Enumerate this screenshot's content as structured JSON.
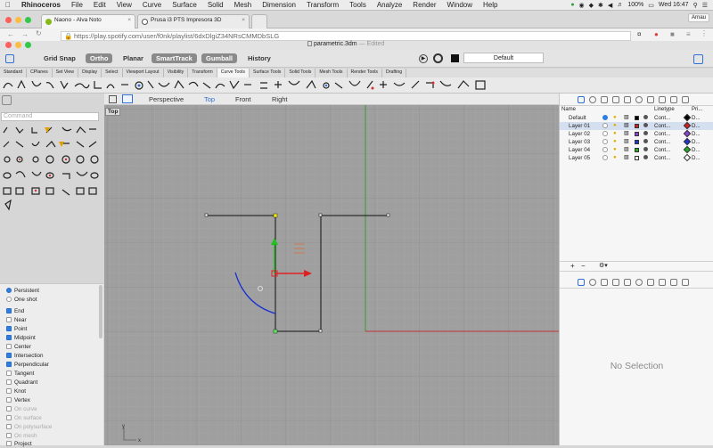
{
  "menubar": {
    "app": "Rhinoceros",
    "items": [
      "File",
      "Edit",
      "View",
      "Curve",
      "Surface",
      "Solid",
      "Mesh",
      "Dimension",
      "Transform",
      "Tools",
      "Analyze",
      "Render",
      "Window",
      "Help"
    ],
    "battery": "100%",
    "clock": "Wed 16:47"
  },
  "browser": {
    "tabs": [
      {
        "label": "Naono - Alva Noto"
      },
      {
        "label": "Prusa i3 PTS Impresora 3D"
      }
    ],
    "user": "Arnau",
    "url": "https://play.spotify.com/user/f0nk/playlist/6dxDlgiZ34NRsCMMDbSLG"
  },
  "rhino": {
    "doc_title": "parametric.3dm",
    "doc_status": "— Edited",
    "modes": [
      {
        "label": "Grid Snap",
        "on": false
      },
      {
        "label": "Ortho",
        "on": true
      },
      {
        "label": "Planar",
        "on": false
      },
      {
        "label": "SmartTrack",
        "on": true
      },
      {
        "label": "Gumball",
        "on": true
      },
      {
        "label": "History",
        "on": false
      }
    ],
    "layer_field": "Default",
    "toolbar_tabs": [
      "Standard",
      "CPlanes",
      "Set View",
      "Display",
      "Select",
      "Viewport Layout",
      "Visibility",
      "Transform",
      "Curve Tools",
      "Surface Tools",
      "Solid Tools",
      "Mesh Tools",
      "Render Tools",
      "Drafting"
    ],
    "active_toolbar_tab": "Curve Tools",
    "command_placeholder": "Command",
    "viewport_tabs": [
      "Perspective",
      "Top",
      "Front",
      "Right"
    ],
    "active_viewport": "Top",
    "viewport_label": "Top",
    "axis_y": "y",
    "axis_x": "x"
  },
  "osnap": {
    "modes": [
      {
        "label": "Persistent",
        "kind": "radio",
        "on": true
      },
      {
        "label": "One shot",
        "kind": "radio",
        "on": false
      }
    ],
    "items": [
      {
        "label": "End",
        "on": true,
        "dim": false
      },
      {
        "label": "Near",
        "on": false,
        "dim": false
      },
      {
        "label": "Point",
        "on": true,
        "dim": false
      },
      {
        "label": "Midpoint",
        "on": true,
        "dim": false
      },
      {
        "label": "Center",
        "on": false,
        "dim": false
      },
      {
        "label": "Intersection",
        "on": true,
        "dim": false
      },
      {
        "label": "Perpendicular",
        "on": true,
        "dim": false
      },
      {
        "label": "Tangent",
        "on": false,
        "dim": false
      },
      {
        "label": "Quadrant",
        "on": false,
        "dim": false
      },
      {
        "label": "Knot",
        "on": false,
        "dim": false
      },
      {
        "label": "Vertex",
        "on": false,
        "dim": false
      },
      {
        "label": "On curve",
        "on": false,
        "dim": true
      },
      {
        "label": "On surface",
        "on": false,
        "dim": true
      },
      {
        "label": "On polysurface",
        "on": false,
        "dim": true
      },
      {
        "label": "On mesh",
        "on": false,
        "dim": true
      },
      {
        "label": "Project",
        "on": false,
        "dim": false
      }
    ]
  },
  "layers": {
    "headers": {
      "name": "Name",
      "linetype": "Linetype",
      "print": "Pri..."
    },
    "rows": [
      {
        "name": "Default",
        "linetype": "Cont...",
        "print": "D...",
        "color": "#000000",
        "current": true,
        "selected": false
      },
      {
        "name": "Layer 01",
        "linetype": "Cont...",
        "print": "D...",
        "color": "#cc2222",
        "current": false,
        "selected": true
      },
      {
        "name": "Layer 02",
        "linetype": "Cont...",
        "print": "D...",
        "color": "#8844cc",
        "current": false,
        "selected": false
      },
      {
        "name": "Layer 03",
        "linetype": "Cont...",
        "print": "D...",
        "color": "#2233cc",
        "current": false,
        "selected": false
      },
      {
        "name": "Layer 04",
        "linetype": "Cont...",
        "print": "D...",
        "color": "#22aa22",
        "current": false,
        "selected": false
      },
      {
        "name": "Layer 05",
        "linetype": "Cont...",
        "print": "D...",
        "color": "#ffffff",
        "current": false,
        "selected": false
      }
    ]
  },
  "properties": {
    "empty_text": "No Selection"
  },
  "colors": {
    "accent": "#2f6fd6",
    "viewport_bg": "#9f9f9f",
    "grid_minor": "#a9a9a9",
    "grid_major": "#8f8f8f",
    "axis_x": "#c03030",
    "axis_y": "#30a030"
  }
}
